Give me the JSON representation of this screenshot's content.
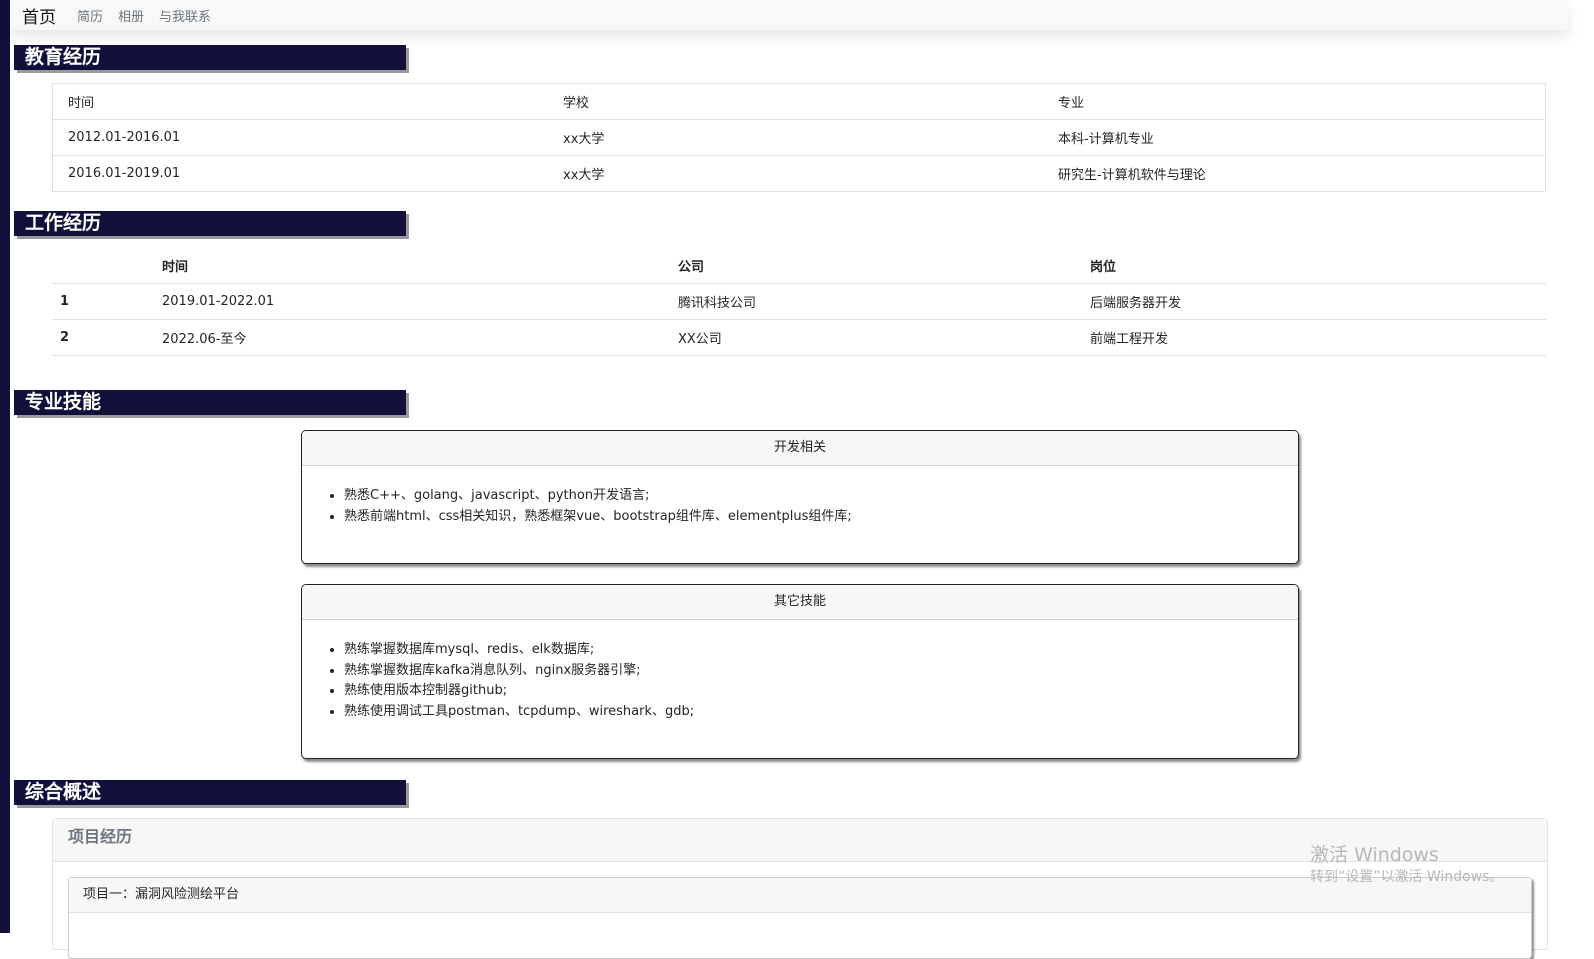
{
  "nav": {
    "brand": "首页",
    "links": [
      "简历",
      "相册",
      "与我联系"
    ]
  },
  "sections": {
    "education": "教育经历",
    "work": "工作经历",
    "skills": "专业技能",
    "overview": "综合概述"
  },
  "education_table": {
    "headers": [
      "时间",
      "学校",
      "专业"
    ],
    "rows": [
      [
        "2012.01-2016.01",
        "xx大学",
        "本科-计算机专业"
      ],
      [
        "2016.01-2019.01",
        "xx大学",
        "研究生-计算机软件与理论"
      ]
    ]
  },
  "work_table": {
    "headers": [
      "",
      "时间",
      "公司",
      "岗位"
    ],
    "rows": [
      [
        "1",
        "2019.01-2022.01",
        "腾讯科技公司",
        "后端服务器开发"
      ],
      [
        "2",
        "2022.06-至今",
        "XX公司",
        "前端工程开发"
      ]
    ]
  },
  "skills": {
    "dev": {
      "title": "开发相关",
      "items": [
        "熟悉C++、golang、javascript、python开发语言;",
        "熟悉前端html、css相关知识，熟悉框架vue、bootstrap组件库、elementplus组件库;"
      ]
    },
    "other": {
      "title": "其它技能",
      "items": [
        "熟练掌握数据库mysql、redis、elk数据库;",
        "熟练掌握数据库kafka消息队列、nginx服务器引擎;",
        "熟练使用版本控制器github;",
        "熟练使用调试工具postman、tcpdump、wireshark、gdb;"
      ]
    }
  },
  "overview": {
    "header": "项目经历",
    "project1_title": "项目一：漏洞风险测绘平台"
  },
  "watermark": {
    "line1": "激活 Windows",
    "line2": "转到“设置”以激活 Windows。"
  }
}
